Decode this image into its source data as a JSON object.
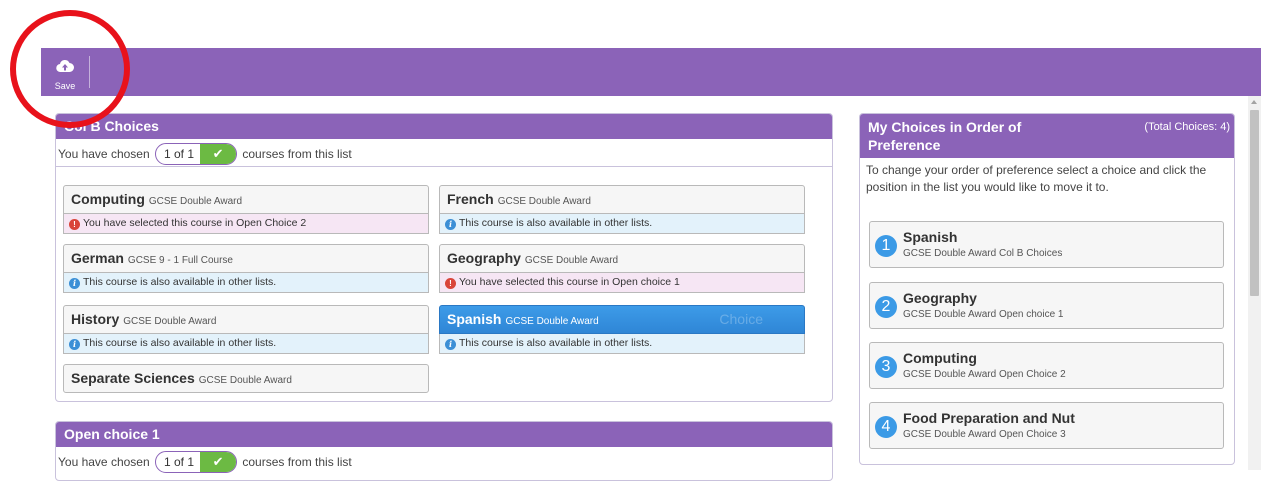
{
  "toolbar": {
    "save_label": "Save"
  },
  "col_b": {
    "title": "Col B Choices",
    "chosen_prefix": "You have chosen",
    "chosen_count": "1 of 1",
    "chosen_suffix": "courses from this list",
    "courses": [
      {
        "name": "Computing",
        "type": "GCSE Double Award",
        "note": "You have selected this course in Open Choice 2",
        "note_kind": "warning"
      },
      {
        "name": "French",
        "type": "GCSE Double Award",
        "note": "This course is also available in other lists.",
        "note_kind": "info"
      },
      {
        "name": "German",
        "type": "GCSE 9 - 1 Full Course",
        "note": "This course is also available in other lists.",
        "note_kind": "info"
      },
      {
        "name": "Geography",
        "type": "GCSE Double Award",
        "note": "You have selected this course in Open choice 1",
        "note_kind": "warning"
      },
      {
        "name": "History",
        "type": "GCSE Double Award",
        "note": "This course is also available in other lists.",
        "note_kind": "info"
      },
      {
        "name": "Spanish",
        "type": "GCSE Double Award",
        "note": "This course is also available in other lists.",
        "note_kind": "info",
        "selected": true,
        "ghost": "Choice"
      },
      {
        "name": "Separate Sciences",
        "type": "GCSE Double Award"
      }
    ]
  },
  "open_choice_1": {
    "title": "Open choice 1",
    "chosen_prefix": "You have chosen",
    "chosen_count": "1 of 1",
    "chosen_suffix": "courses from this list"
  },
  "preferences": {
    "title": "My Choices in Order of Preference",
    "total": "(Total Choices: 4)",
    "description": "To change your order of preference select a choice and click the position in the list you would like to move it to.",
    "items": [
      {
        "rank": "1",
        "name": "Spanish",
        "detail": "GCSE Double Award Col B Choices"
      },
      {
        "rank": "2",
        "name": "Geography",
        "detail": "GCSE Double Award Open choice 1"
      },
      {
        "rank": "3",
        "name": "Computing",
        "detail": "GCSE Double Award Open Choice 2"
      },
      {
        "rank": "4",
        "name": "Food Preparation and Nut",
        "detail": "GCSE Double Award Open Choice 3"
      }
    ]
  },
  "colors": {
    "accent": "#8b63b8",
    "selected": "#3d9be8",
    "check": "#6cba43",
    "annotation": "#e8121b"
  }
}
